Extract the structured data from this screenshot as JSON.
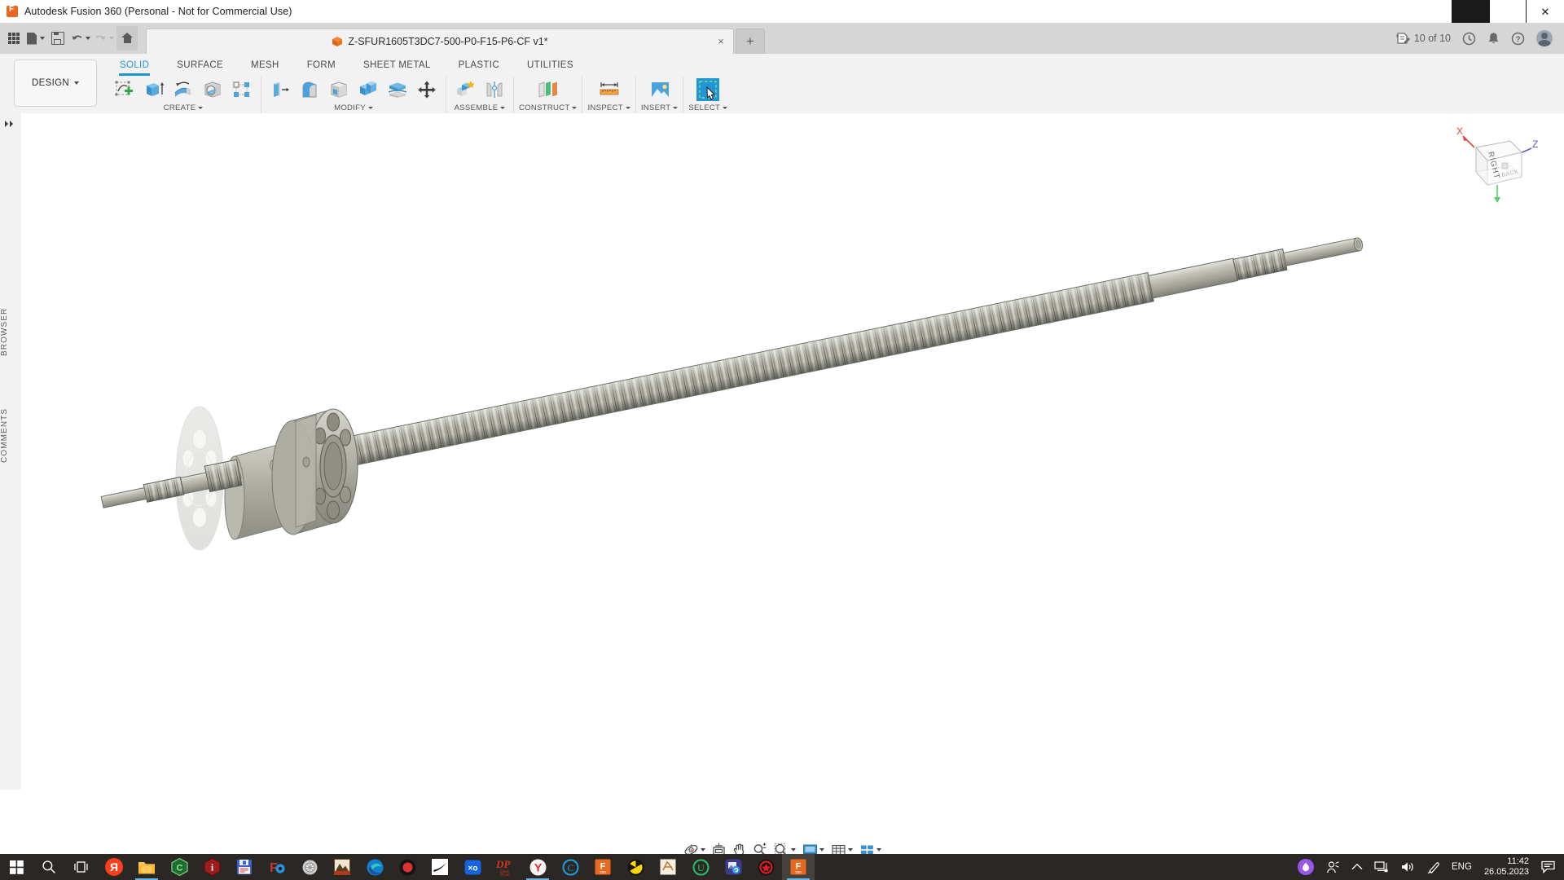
{
  "window": {
    "title": "Autodesk Fusion 360 (Personal - Not for Commercial Use)",
    "app_icon": "fusion360-icon",
    "minimize": "minimize-icon",
    "maximize": "maximize-icon",
    "close": "close-icon"
  },
  "quick_access": {
    "app_grid": "app-grid-icon",
    "new_file": "new-file-icon",
    "save": "save-icon",
    "undo": "undo-icon",
    "redo": "redo-icon",
    "home": "home-icon"
  },
  "document_tab": {
    "icon": "orange-cube-icon",
    "label": "Z-SFUR1605T3DC7-500-P0-F15-P6-CF v1*",
    "close_label": "×",
    "new_tab_label": "+"
  },
  "tab_bar_right": {
    "jobs_icon": "job-status-icon",
    "jobs_label": "10 of 10",
    "history_icon": "clock-history-icon",
    "notifications_icon": "bell-icon",
    "help_icon": "help-question-icon",
    "account_icon": "user-avatar"
  },
  "ribbon": {
    "design_dropdown": "DESIGN",
    "tabs": [
      {
        "label": "SOLID",
        "active": true
      },
      {
        "label": "SURFACE",
        "active": false
      },
      {
        "label": "MESH",
        "active": false
      },
      {
        "label": "FORM",
        "active": false
      },
      {
        "label": "SHEET METAL",
        "active": false
      },
      {
        "label": "PLASTIC",
        "active": false
      },
      {
        "label": "UTILITIES",
        "active": false
      }
    ],
    "panels": [
      {
        "label": "CREATE",
        "has_dropdown": true,
        "tools": [
          "create-sketch-icon",
          "extrude-icon",
          "revolve-icon",
          "hole-icon",
          "pattern-icon"
        ]
      },
      {
        "label": "MODIFY",
        "has_dropdown": true,
        "tools": [
          "press-pull-icon",
          "fillet-icon",
          "shell-icon",
          "combine-icon",
          "split-face-icon",
          "move-copy-icon"
        ]
      },
      {
        "label": "ASSEMBLE",
        "has_dropdown": true,
        "tools": [
          "new-component-icon",
          "joint-icon"
        ]
      },
      {
        "label": "CONSTRUCT",
        "has_dropdown": true,
        "tools": [
          "offset-plane-icon"
        ]
      },
      {
        "label": "INSPECT",
        "has_dropdown": true,
        "tools": [
          "measure-icon"
        ]
      },
      {
        "label": "INSERT",
        "has_dropdown": true,
        "tools": [
          "insert-image-icon"
        ]
      },
      {
        "label": "SELECT",
        "has_dropdown": true,
        "tools": [
          "select-window-icon"
        ]
      }
    ]
  },
  "left_dock": {
    "collapse_icon": "double-chevron-right-icon",
    "browser_label": "BROWSER",
    "comments_label": "COMMENTS"
  },
  "canvas": {
    "model_name": "ball-screw-assembly",
    "background_color": "#ffffff",
    "body_color": "#a8a89c"
  },
  "view_cube": {
    "front_face_label": "RIGHT",
    "axis_x_label": "X",
    "axis_x_color": "#e8413c",
    "axis_y_color": "#52d06a",
    "axis_z_label": "Z",
    "axis_z_color": "#5b5bd6"
  },
  "nav_bar": {
    "items": [
      "orbit-icon",
      "fit-to-view-icon",
      "pan-icon",
      "zoom-icon",
      "zoom-window-icon",
      "display-settings-icon",
      "grid-snaps-icon",
      "viewports-icon"
    ]
  },
  "taskbar": {
    "start": "windows-start-icon",
    "search": "search-icon",
    "task_view": "task-view-icon",
    "apps": [
      {
        "name": "yandex-browser-icon",
        "glyph": "Я",
        "bg": "#fc3f1d",
        "fg": "#ffffff",
        "shape": "circle",
        "state": ""
      },
      {
        "name": "file-explorer-icon",
        "glyph": "",
        "bg": "#ffb900",
        "fg": "#ffffff",
        "shape": "folder",
        "state": "running"
      },
      {
        "name": "c-hexagon-icon",
        "glyph": "C",
        "bg": "#1f7a38",
        "fg": "#8ee07f",
        "shape": "hex",
        "state": ""
      },
      {
        "name": "info-hexagon-icon",
        "glyph": "i",
        "bg": "#a11b1b",
        "fg": "#ffffff",
        "shape": "hex",
        "state": ""
      },
      {
        "name": "floppy-save-icon",
        "glyph": "",
        "bg": "#3355cc",
        "fg": "#ffffff",
        "shape": "floppy",
        "state": ""
      },
      {
        "name": "foxit-gear-icon",
        "glyph": "F",
        "bg": "#c0392b",
        "fg": "#2d8fd8",
        "shape": "square",
        "state": ""
      },
      {
        "name": "gear-globe-icon",
        "glyph": "",
        "bg": "#b9b9b9",
        "fg": "#666666",
        "shape": "gear",
        "state": ""
      },
      {
        "name": "archive-manager-icon",
        "glyph": "",
        "bg": "#e7dfcf",
        "fg": "#8a3a1a",
        "shape": "square",
        "state": ""
      },
      {
        "name": "edge-browser-icon",
        "glyph": "",
        "bg": "#0e8ad8",
        "fg": "#39d1b4",
        "shape": "circle",
        "state": ""
      },
      {
        "name": "record-app-icon",
        "glyph": "",
        "bg": "#1a1a1a",
        "fg": "#d62a2a",
        "shape": "circle",
        "state": ""
      },
      {
        "name": "swoosh-app-icon",
        "glyph": "",
        "bg": "#ffffff",
        "fg": "#111111",
        "shape": "square",
        "state": ""
      },
      {
        "name": "xo-app-icon",
        "glyph": "×o",
        "bg": "#1565e0",
        "fg": "#ffffff",
        "shape": "square",
        "state": ""
      },
      {
        "name": "deskprota-icon",
        "glyph": "DP",
        "bg": "#2b2724",
        "fg": "#cf3a1e",
        "shape": "plain",
        "state": ""
      },
      {
        "name": "yandex-y-icon",
        "glyph": "Y",
        "bg": "#f2f2f2",
        "fg": "#d8342b",
        "shape": "circle",
        "state": "running"
      },
      {
        "name": "copyright-c-icon",
        "glyph": "C",
        "bg": "#2b2724",
        "fg": "#1f9fe0",
        "shape": "circle-outline",
        "state": ""
      },
      {
        "name": "fusion360-taskbar-icon",
        "glyph": "F",
        "bg": "#e8681f",
        "fg": "#ffffff",
        "shape": "square",
        "state": ""
      },
      {
        "name": "radiation-app-icon",
        "glyph": "",
        "bg": "#111111",
        "fg": "#ffd700",
        "shape": "circle",
        "state": ""
      },
      {
        "name": "sketch-ribbon-icon",
        "glyph": "S",
        "bg": "#f5efe3",
        "fg": "#c07a3e",
        "shape": "square",
        "state": ""
      },
      {
        "name": "u-circle-icon",
        "glyph": "U",
        "bg": "#2b2724",
        "fg": "#24c26a",
        "shape": "circle-outline",
        "state": ""
      },
      {
        "name": "photo-sync-icon",
        "glyph": "",
        "bg": "#3b3b8f",
        "fg": "#ffffff",
        "shape": "square",
        "state": ""
      },
      {
        "name": "red-gear-icon",
        "glyph": "",
        "bg": "#171717",
        "fg": "#e02020",
        "shape": "circle",
        "state": ""
      },
      {
        "name": "fusion360-active-icon",
        "glyph": "F",
        "bg": "#e8681f",
        "fg": "#ffffff",
        "shape": "square",
        "state": "active"
      }
    ],
    "tray": {
      "assistant_icon": "alice-assistant-icon",
      "people_icon": "people-icon",
      "overflow_icon": "show-hidden-icons-chevron",
      "network_icon": "network-icon",
      "volume_icon": "volume-icon",
      "pen_icon": "pen-icon",
      "language": "ENG",
      "time": "11:42",
      "date": "26.05.2023",
      "action_center_icon": "action-center-icon"
    }
  }
}
